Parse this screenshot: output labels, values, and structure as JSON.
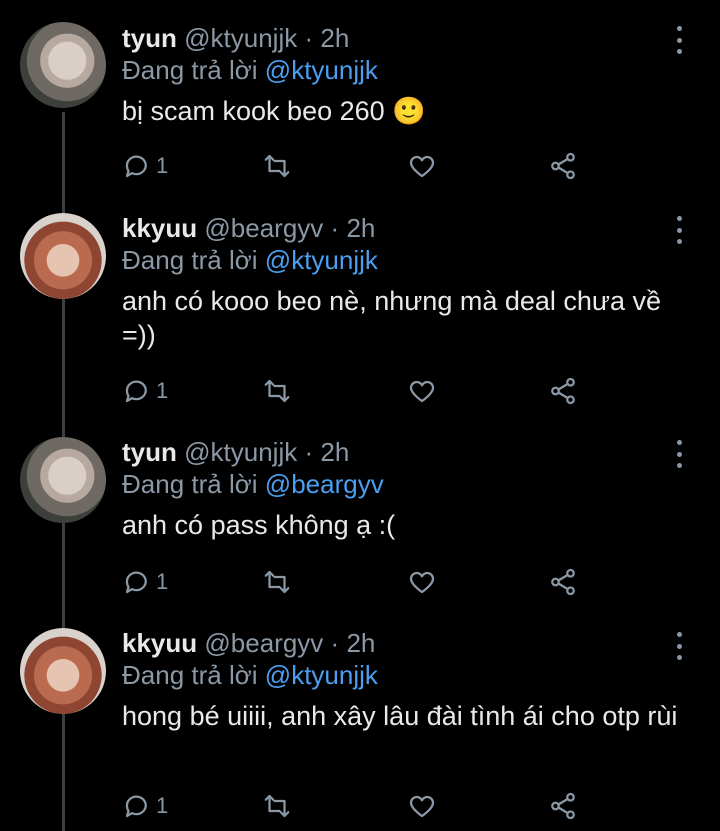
{
  "tweets": [
    {
      "name": "tyun",
      "handle": "@ktyunjjk",
      "time": "2h",
      "reply_prefix": "Đang trả lời",
      "reply_to": "@ktyunjjk",
      "text": "bị scam kook beo 260 🙂",
      "reply_count": "1",
      "avatar_icon": "avatar-tyun"
    },
    {
      "name": "kkyuu",
      "handle": "@beargyv",
      "time": "2h",
      "reply_prefix": "Đang trả lời",
      "reply_to": "@ktyunjjk",
      "text": "anh có kooo beo nè, nhưng mà deal chưa về =))",
      "reply_count": "1",
      "avatar_icon": "avatar-kkyuu"
    },
    {
      "name": "tyun",
      "handle": "@ktyunjjk",
      "time": "2h",
      "reply_prefix": "Đang trả lời",
      "reply_to": "@beargyv",
      "text": "anh có pass không ạ :(",
      "reply_count": "1",
      "avatar_icon": "avatar-tyun"
    },
    {
      "name": "kkyuu",
      "handle": "@beargyv",
      "time": "2h",
      "reply_prefix": "Đang trả lời",
      "reply_to": "@ktyunjjk",
      "text": "hong bé uiiii, anh xây lâu đài tình ái cho otp rùi",
      "reply_count": "1",
      "avatar_icon": "avatar-kkyuu"
    }
  ],
  "separator": "·",
  "colors": {
    "background": "#000000",
    "text": "#e7e9ea",
    "muted": "#8b98a5",
    "mention": "#4a9ff0"
  }
}
